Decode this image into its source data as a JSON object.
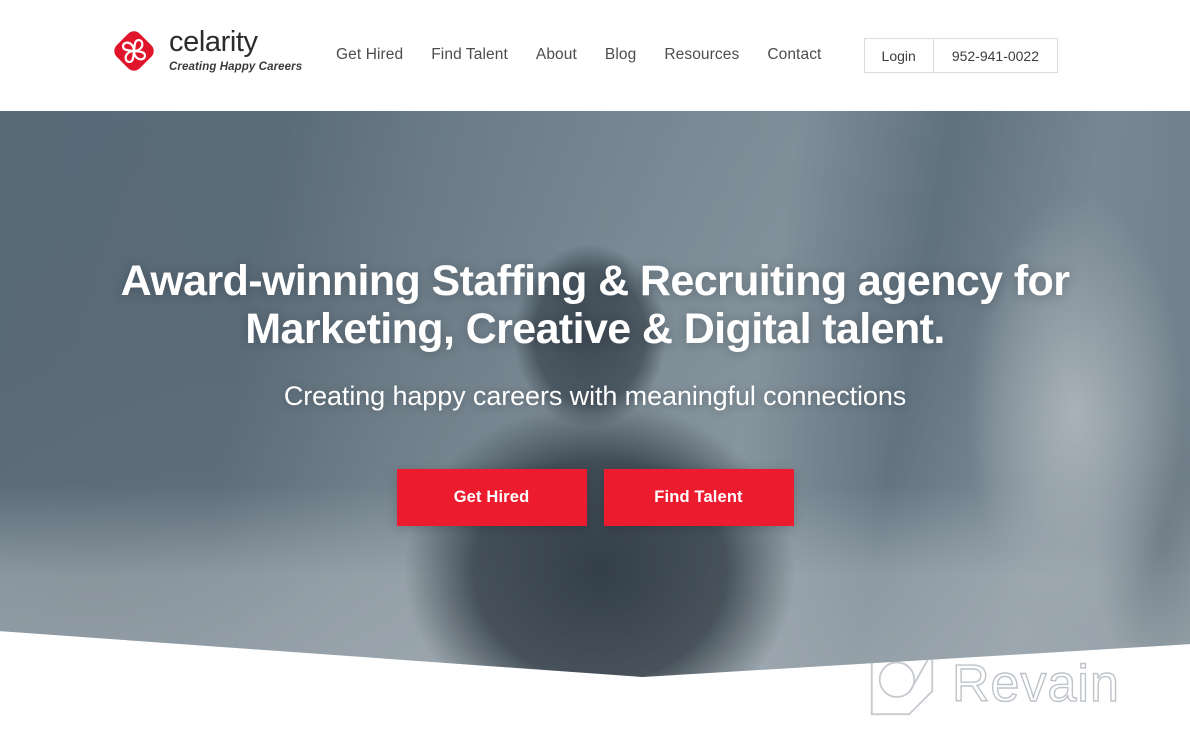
{
  "header": {
    "brand": {
      "name": "celarity",
      "tagline": "Creating Happy Careers",
      "logo_icon": "celarity-diamond-logo",
      "logo_color": "#e0152b"
    },
    "nav": [
      {
        "label": "Get Hired"
      },
      {
        "label": "Find Talent"
      },
      {
        "label": "About"
      },
      {
        "label": "Blog"
      },
      {
        "label": "Resources"
      },
      {
        "label": "Contact"
      }
    ],
    "actions": {
      "login_label": "Login",
      "phone_label": "952-941-0022"
    }
  },
  "hero": {
    "title": "Award-winning Staffing & Recruiting agency for Marketing, Creative & Digital talent.",
    "subtitle": "Creating happy careers with meaningful connections",
    "buttons": [
      {
        "label": "Get Hired"
      },
      {
        "label": "Find Talent"
      }
    ],
    "accent_color": "#ec1b2e"
  },
  "watermark": {
    "text": "Revain",
    "icon": "revain-magnifier-logo",
    "color": "#969ea8"
  }
}
